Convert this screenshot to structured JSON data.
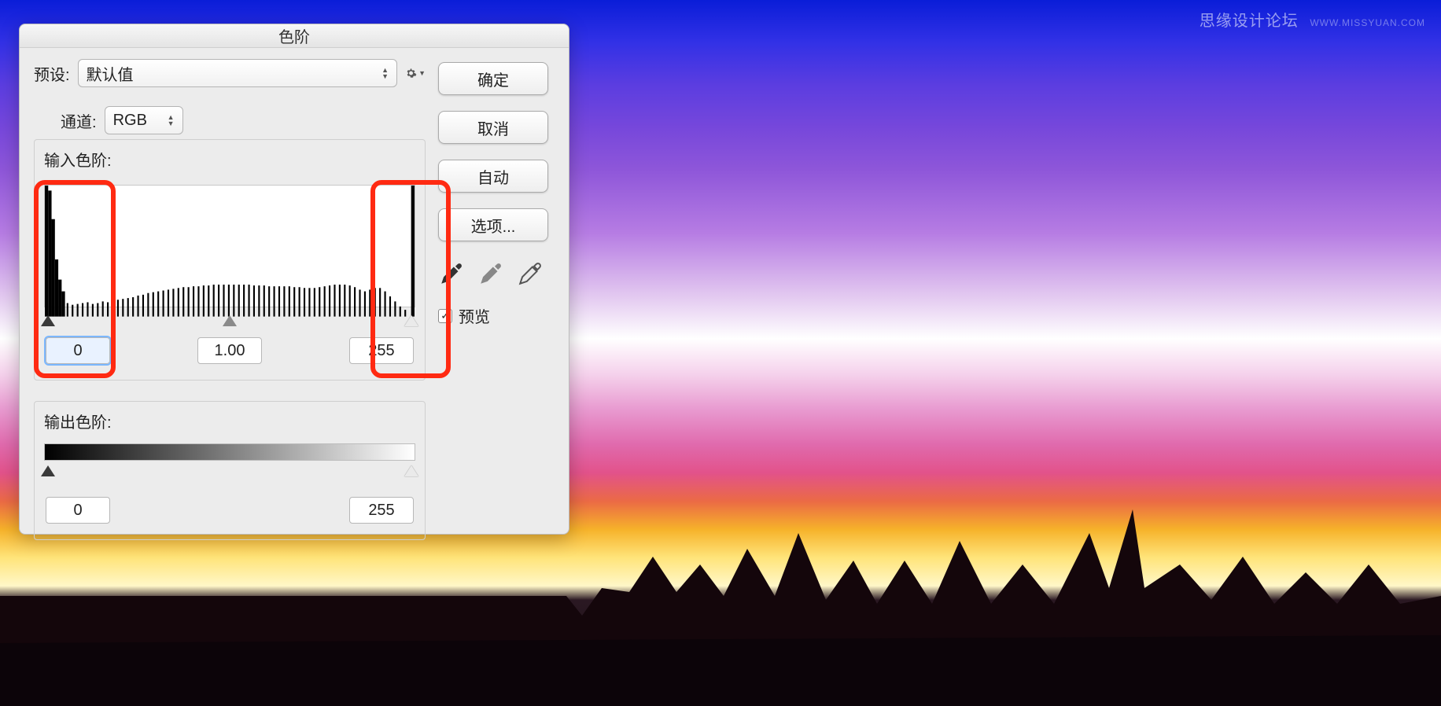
{
  "watermark": {
    "text": "思缘设计论坛",
    "url": "WWW.MISSYUAN.COM"
  },
  "dialog": {
    "title": "色阶",
    "preset": {
      "label": "预设:",
      "value": "默认值"
    },
    "gear_icon": "gear-icon",
    "channel": {
      "label": "通道:",
      "value": "RGB"
    },
    "input_levels": {
      "label": "输入色阶:",
      "black": "0",
      "gamma": "1.00",
      "white": "255"
    },
    "output_levels": {
      "label": "输出色阶:",
      "black": "0",
      "white": "255"
    },
    "buttons": {
      "ok": "确定",
      "cancel": "取消",
      "auto": "自动",
      "options": "选项..."
    },
    "eyedroppers": [
      "black-point-eyedropper",
      "gray-point-eyedropper",
      "white-point-eyedropper"
    ],
    "preview": {
      "checked": true,
      "label": "预览"
    }
  }
}
